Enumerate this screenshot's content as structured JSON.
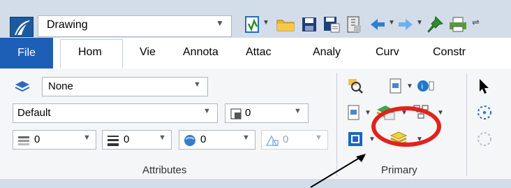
{
  "title_bar": {
    "workflow": "Drawing",
    "icons": [
      "microstation-logo-icon",
      "workflow-dropdown-arrow-icon",
      "file-new-icon",
      "open-folder-icon",
      "save-icon",
      "save-settings-icon",
      "compress-icon",
      "undo-icon",
      "redo-icon",
      "pushpin-icon",
      "print-icon"
    ]
  },
  "tabs": [
    "File",
    "Hom",
    "Vie",
    "Annota",
    "Attac",
    "Analy",
    "Curv",
    "Constr"
  ],
  "active_tab": "Hom",
  "attributes": {
    "level_value": "None",
    "style_value": "Default",
    "color_value": "0",
    "weight_value": "0",
    "line_style_value": "0",
    "transparency_value": "0",
    "priority_value": "0",
    "label": "Attributes"
  },
  "primary": {
    "label": "Primary",
    "icons": [
      "explorer-search-icon",
      "models-icon",
      "info-icon",
      "references-icon",
      "level-manager-icon",
      "display-icon",
      "view-attributes-icon",
      "level-display-icon"
    ],
    "highlighted": "level-display-icon"
  },
  "colors": {
    "accent": "#1d5fb6",
    "titlebar": "#d2dde9",
    "highlight": "#e0231d"
  }
}
